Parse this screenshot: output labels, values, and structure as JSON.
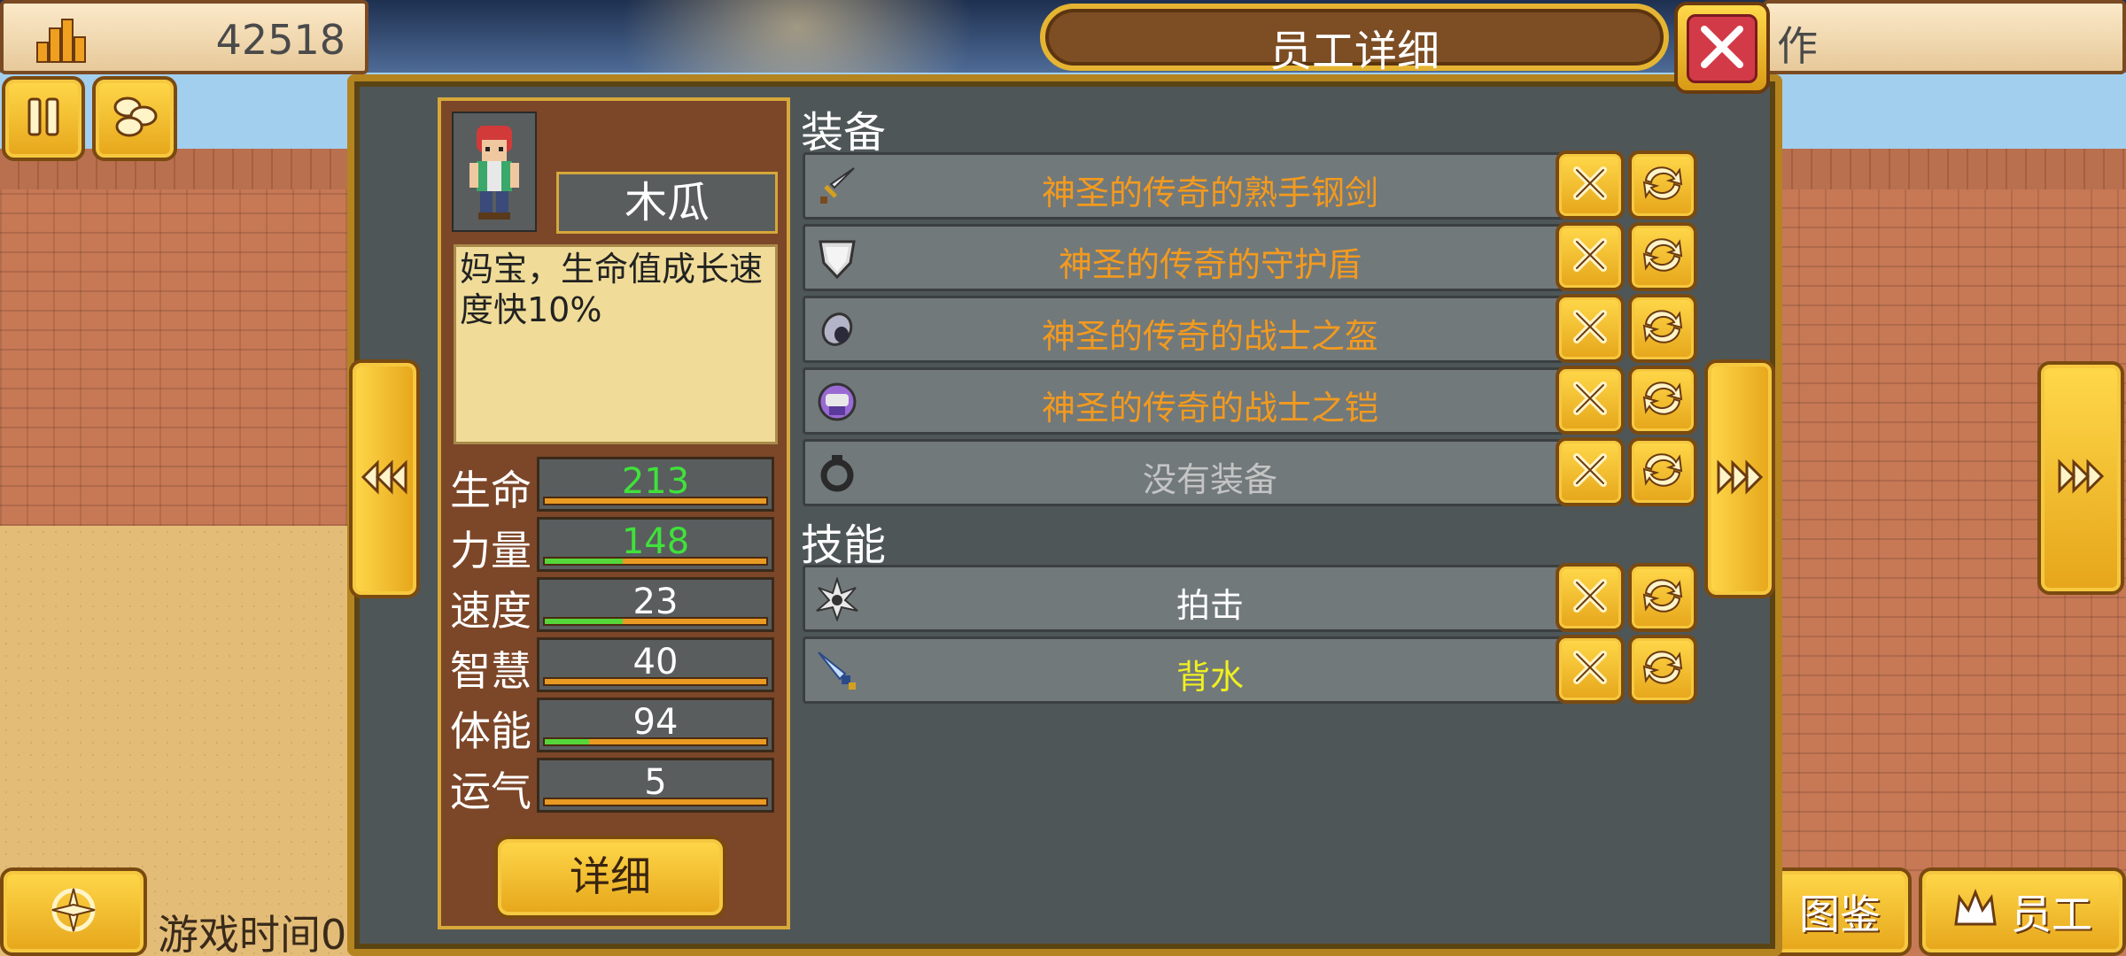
{
  "hud": {
    "money_icon": "building-coins-icon",
    "money": "42518",
    "top_right_text": "作",
    "game_time_label": "游戏时间0",
    "catalog_label": "图鉴",
    "staff_label": "员工"
  },
  "dialog": {
    "title": "员工详细",
    "close_icon": "close-icon",
    "prev_icon": "chevrons-left-icon",
    "next_icon": "chevrons-right-icon"
  },
  "character": {
    "name": "木瓜",
    "description": "妈宝，生命值成长速度快10%",
    "detail_button": "详细",
    "stats": [
      {
        "label": "生命",
        "value": "213",
        "value_color": "#3fe23a",
        "fill_fraction": 0.0
      },
      {
        "label": "力量",
        "value": "148",
        "value_color": "#3fe23a",
        "fill_fraction": 0.35
      },
      {
        "label": "速度",
        "value": "23",
        "value_color": "#ffffff",
        "fill_fraction": 0.35
      },
      {
        "label": "智慧",
        "value": "40",
        "value_color": "#ffffff",
        "fill_fraction": 0.0
      },
      {
        "label": "体能",
        "value": "94",
        "value_color": "#ffffff",
        "fill_fraction": 0.2
      },
      {
        "label": "运气",
        "value": "5",
        "value_color": "#ffffff",
        "fill_fraction": 0.0
      }
    ]
  },
  "equipment": {
    "title": "装备",
    "items": [
      {
        "icon": "sword-icon",
        "name": "神圣的传奇的熟手钢剑",
        "color": "#f39a1e"
      },
      {
        "icon": "shield-icon",
        "name": "神圣的传奇的守护盾",
        "color": "#f39a1e"
      },
      {
        "icon": "helmet-icon",
        "name": "神圣的传奇的战士之盔",
        "color": "#f39a1e"
      },
      {
        "icon": "armor-icon",
        "name": "神圣的传奇的战士之铠",
        "color": "#f39a1e"
      },
      {
        "icon": "ring-icon",
        "name": "没有装备",
        "color": "#c4c4c4"
      }
    ]
  },
  "skills": {
    "title": "技能",
    "items": [
      {
        "icon": "strike-icon",
        "name": "拍击",
        "color": "#ffffff"
      },
      {
        "icon": "blade-icon",
        "name": "背水",
        "color": "#f0f020"
      }
    ]
  },
  "colors": {
    "gold": "#e6a51a",
    "panel_gray": "#4f5657",
    "legendary_orange": "#f39a1e"
  }
}
